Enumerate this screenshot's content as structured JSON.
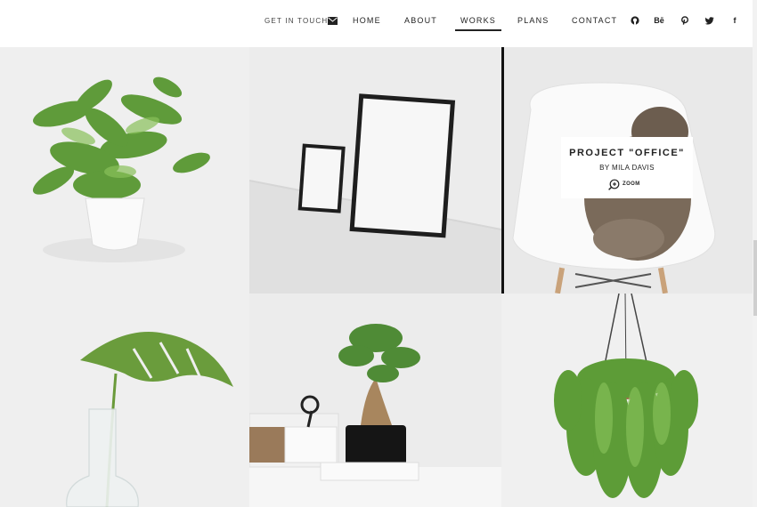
{
  "header": {
    "get_in_touch": "GET IN TOUCH",
    "mail_icon": "envelope-icon",
    "nav": [
      {
        "label": "HOME",
        "active": false
      },
      {
        "label": "ABOUT",
        "active": false
      },
      {
        "label": "WORKS",
        "active": true
      },
      {
        "label": "PLANS",
        "active": false
      },
      {
        "label": "CONTACT",
        "active": false
      }
    ],
    "social": [
      {
        "icon": "github-icon",
        "glyph": ""
      },
      {
        "icon": "behance-icon",
        "glyph": "Bē"
      },
      {
        "icon": "pinterest-icon",
        "glyph": ""
      },
      {
        "icon": "twitter-icon",
        "glyph": ""
      },
      {
        "icon": "facebook-icon",
        "glyph": "f"
      }
    ]
  },
  "portfolio": {
    "items": [
      {
        "image": "potted-fern-plant"
      },
      {
        "image": "empty-black-picture-frames"
      },
      {
        "image": "cat-on-white-chair"
      },
      {
        "image": "monstera-leaf-in-glass-vase"
      },
      {
        "image": "bonsai-on-desk-with-scissors"
      },
      {
        "image": "hanging-plant-basket"
      }
    ],
    "hover_card": {
      "title": "PROJECT \"OFFICE\"",
      "author": "BY MILA DAVIS",
      "zoom_label": "ZOOM"
    }
  }
}
